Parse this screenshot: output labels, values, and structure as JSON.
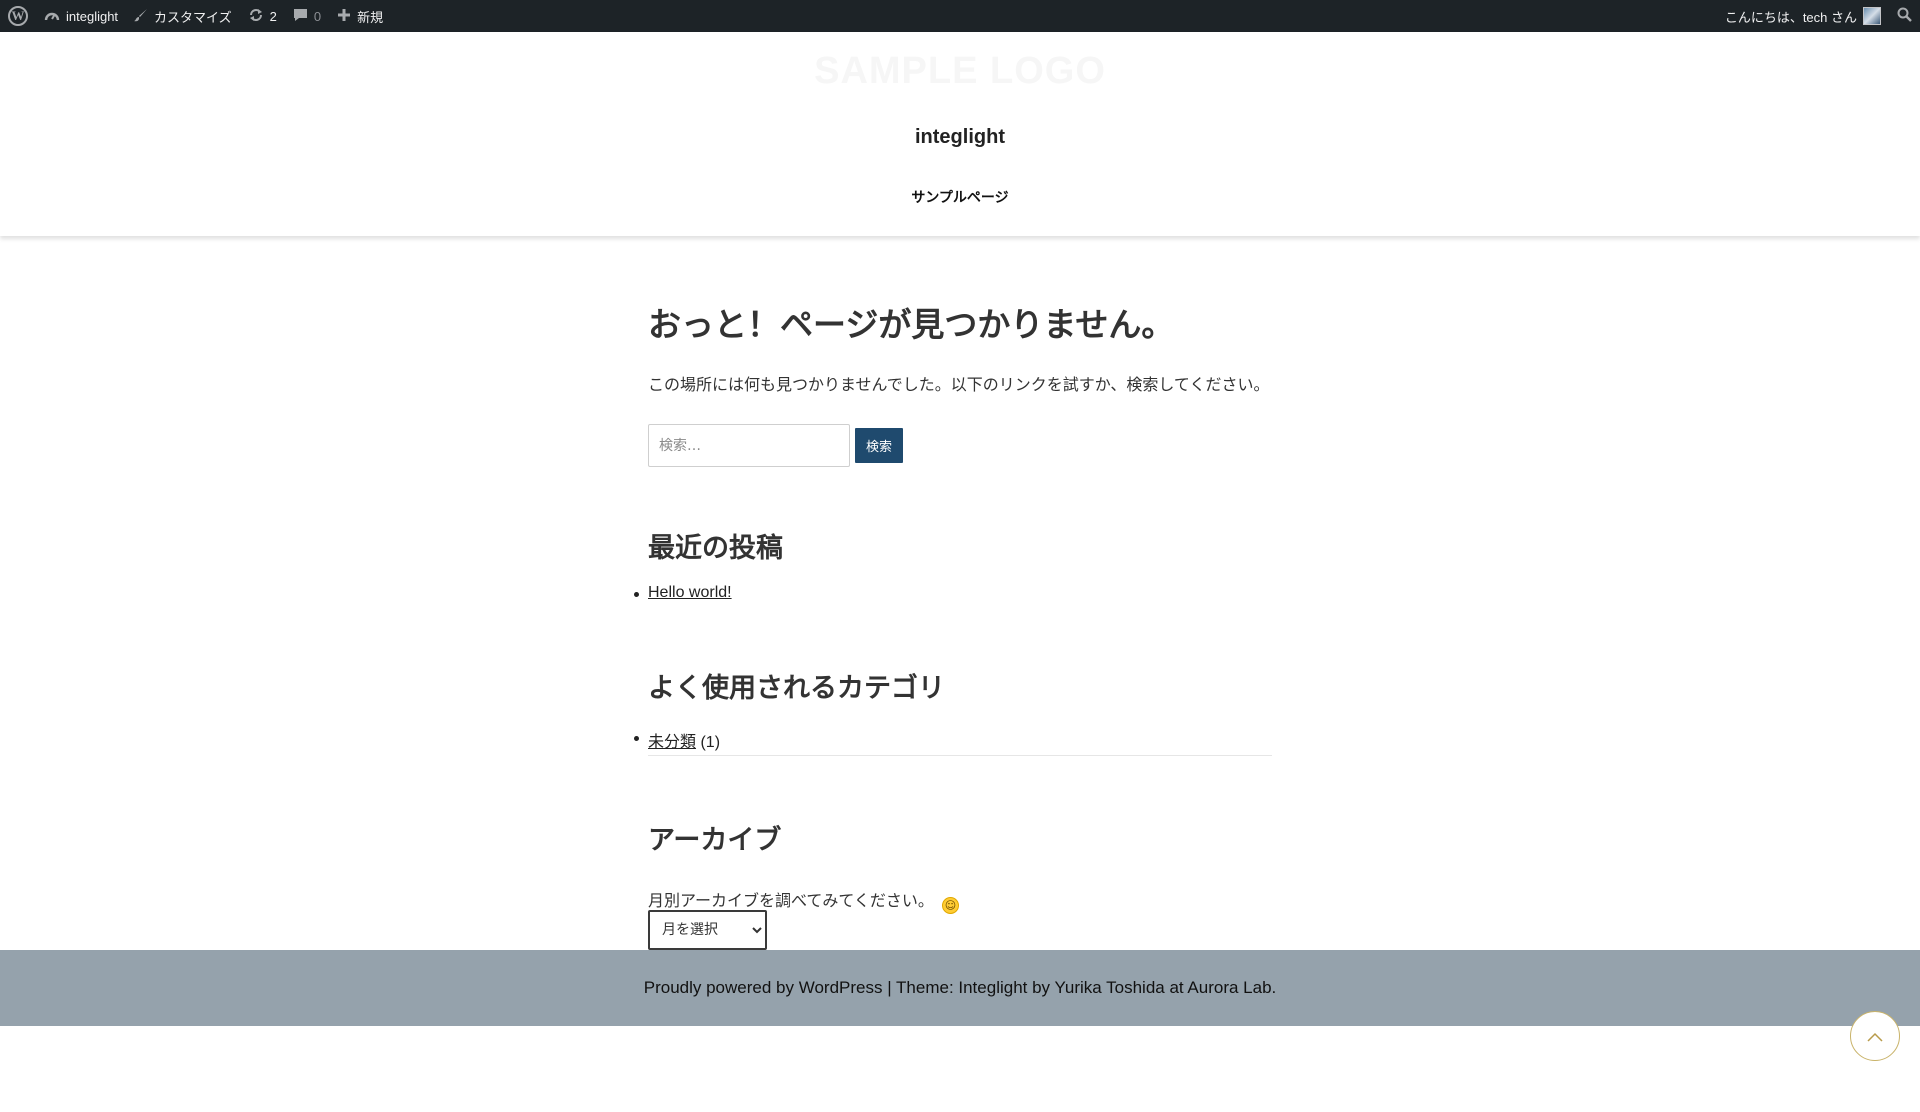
{
  "adminbar": {
    "wp_logo_glyph": "W",
    "site_name": "integlight",
    "customize_label": "カスタマイズ",
    "updates_count": "2",
    "comments_count": "0",
    "new_label": "新規",
    "greeting": "こんにちは、tech さん"
  },
  "header": {
    "logo_text": "SAMPLE LOGO",
    "site_title": "integlight",
    "nav": {
      "sample_page": "サンプルページ"
    }
  },
  "main": {
    "title": "おっと！ページが見つかりません。",
    "intro": "この場所には何も見つかりませんでした。以下のリンクを試すか、検索してください。",
    "search": {
      "placeholder": "検索…",
      "button_label": "検索"
    },
    "recent_posts": {
      "title": "最近の投稿",
      "items": [
        {
          "label": "Hello world!"
        }
      ]
    },
    "categories": {
      "title": "よく使用されるカテゴリ",
      "items": [
        {
          "label": "未分類",
          "count": "(1)"
        }
      ]
    },
    "archives": {
      "title": "アーカイブ",
      "text": "月別アーカイブを調べてみてください。",
      "smiley": "🙂",
      "select_value": "月を選択"
    }
  },
  "footer": {
    "text": "Proudly powered by WordPress | Theme: Integlight by Yurika Toshida at Aurora Lab."
  },
  "back_to_top_glyph": "︿",
  "colors": {
    "adminbar_bg": "#1d2327",
    "search_button": "#1f4a6e",
    "footer_bg": "#95a2ac",
    "back_to_top_border": "#c9b36a"
  }
}
